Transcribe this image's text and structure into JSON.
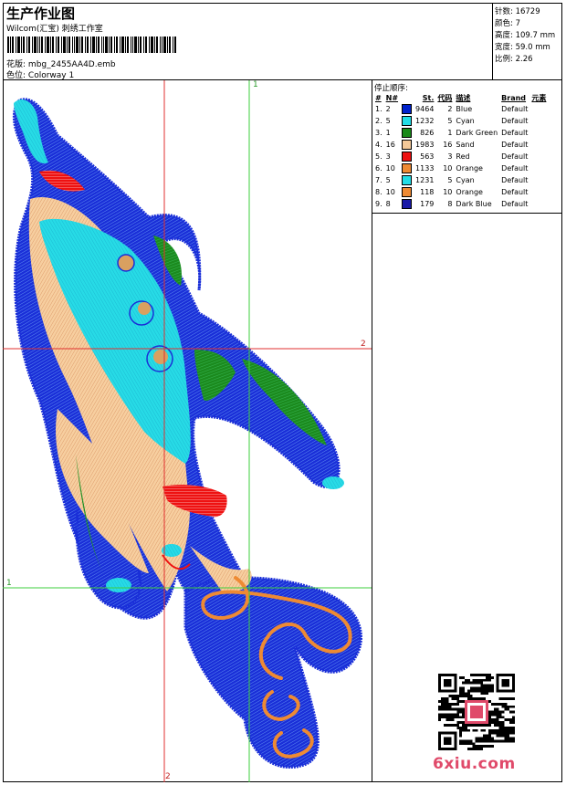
{
  "header": {
    "title": "生产作业图",
    "company": "Wilcom(汇宝) 刺绣工作室",
    "design_label": "花版:",
    "design_file": "mbg_2455AA4D.emb",
    "color_label": "色位:",
    "colorway": "Colorway 1"
  },
  "stats": [
    {
      "label": "针数:",
      "value": "16729"
    },
    {
      "label": "颜色:",
      "value": "7"
    },
    {
      "label": "高度:",
      "value": "109.7 mm"
    },
    {
      "label": "宽度:",
      "value": "59.0 mm"
    },
    {
      "label": "比例:",
      "value": "2.26"
    }
  ],
  "sequence": {
    "label": "停止顺序:",
    "headers": [
      "#",
      "N#",
      "St.",
      "代码",
      "描述",
      "Brand",
      "元素"
    ],
    "rows": [
      {
        "idx": "1.",
        "n": "2",
        "color": "#0022cc",
        "st": "9464",
        "code": "2",
        "desc": "Blue",
        "brand": "Default"
      },
      {
        "idx": "2.",
        "n": "5",
        "color": "#22dde6",
        "st": "1232",
        "code": "5",
        "desc": "Cyan",
        "brand": "Default"
      },
      {
        "idx": "3.",
        "n": "1",
        "color": "#1a8a1a",
        "st": "826",
        "code": "1",
        "desc": "Dark Green",
        "brand": "Default"
      },
      {
        "idx": "4.",
        "n": "16",
        "color": "#f3c898",
        "st": "1983",
        "code": "16",
        "desc": "Sand",
        "brand": "Default"
      },
      {
        "idx": "5.",
        "n": "3",
        "color": "#ee1111",
        "st": "563",
        "code": "3",
        "desc": "Red",
        "brand": "Default"
      },
      {
        "idx": "6.",
        "n": "10",
        "color": "#ee8a33",
        "st": "1133",
        "code": "10",
        "desc": "Orange",
        "brand": "Default"
      },
      {
        "idx": "7.",
        "n": "5",
        "color": "#22dde6",
        "st": "1231",
        "code": "5",
        "desc": "Cyan",
        "brand": "Default"
      },
      {
        "idx": "8.",
        "n": "10",
        "color": "#ee8a33",
        "st": "118",
        "code": "10",
        "desc": "Orange",
        "brand": "Default"
      },
      {
        "idx": "9.",
        "n": "8",
        "color": "#1a1aa8",
        "st": "179",
        "code": "8",
        "desc": "Dark Blue",
        "brand": "Default"
      }
    ]
  },
  "markers": {
    "v1": "1",
    "h2": "2",
    "h1": "1",
    "v2": "2"
  },
  "watermark": "6xiu.com"
}
